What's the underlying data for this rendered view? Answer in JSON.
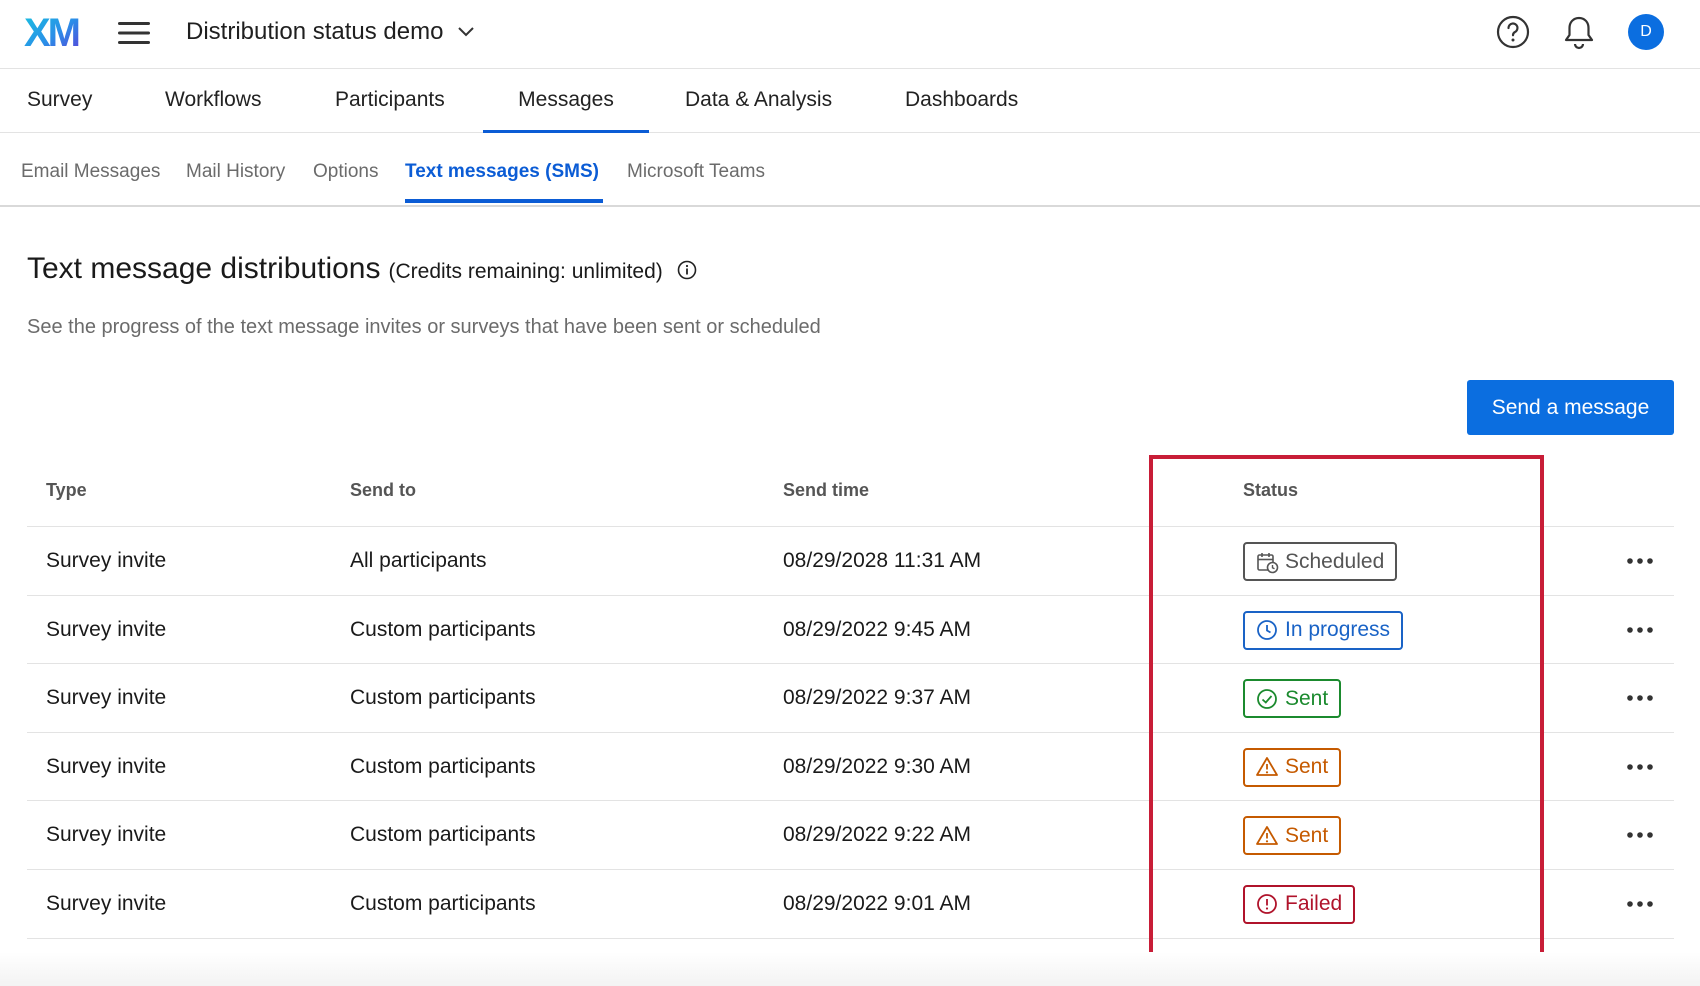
{
  "topbar": {
    "logo_text": "XM",
    "project_title": "Distribution status demo",
    "avatar_initial": "D",
    "icons": [
      "hamburger-menu-icon",
      "chevron-down-icon",
      "help-icon",
      "bell-icon"
    ]
  },
  "main_nav": {
    "tabs": [
      {
        "label": "Survey",
        "active": false
      },
      {
        "label": "Workflows",
        "active": false
      },
      {
        "label": "Participants",
        "active": false
      },
      {
        "label": "Messages",
        "active": true
      },
      {
        "label": "Data & Analysis",
        "active": false
      },
      {
        "label": "Dashboards",
        "active": false
      }
    ]
  },
  "sub_nav": {
    "tabs": [
      {
        "label": "Email Messages",
        "active": false
      },
      {
        "label": "Mail History",
        "active": false
      },
      {
        "label": "Options",
        "active": false
      },
      {
        "label": "Text messages (SMS)",
        "active": true
      },
      {
        "label": "Microsoft Teams",
        "active": false
      }
    ]
  },
  "page": {
    "title": "Text message distributions",
    "credits": "(Credits remaining: unlimited)",
    "description": "See the progress of the text message invites or surveys that have been sent or scheduled",
    "send_button": "Send a message"
  },
  "table": {
    "headers": {
      "type": "Type",
      "send_to": "Send to",
      "send_time": "Send time",
      "status": "Status"
    },
    "rows": [
      {
        "type": "Survey invite",
        "send_to": "All participants",
        "send_time": "08/29/2028 11:31 AM",
        "status": "Scheduled",
        "status_kind": "scheduled",
        "status_icon": "calendar-clock-icon"
      },
      {
        "type": "Survey invite",
        "send_to": "Custom participants",
        "send_time": "08/29/2022 9:45 AM",
        "status": "In progress",
        "status_kind": "progress",
        "status_icon": "clock-icon"
      },
      {
        "type": "Survey invite",
        "send_to": "Custom participants",
        "send_time": "08/29/2022 9:37 AM",
        "status": "Sent",
        "status_kind": "sent",
        "status_icon": "check-circle-icon"
      },
      {
        "type": "Survey invite",
        "send_to": "Custom participants",
        "send_time": "08/29/2022 9:30 AM",
        "status": "Sent",
        "status_kind": "warning",
        "status_icon": "warning-triangle-icon"
      },
      {
        "type": "Survey invite",
        "send_to": "Custom participants",
        "send_time": "08/29/2022 9:22 AM",
        "status": "Sent",
        "status_kind": "warning",
        "status_icon": "warning-triangle-icon"
      },
      {
        "type": "Survey invite",
        "send_to": "Custom participants",
        "send_time": "08/29/2022 9:01 AM",
        "status": "Failed",
        "status_kind": "failed",
        "status_icon": "error-circle-icon"
      }
    ]
  },
  "colors": {
    "primary": "#0b6ee0",
    "active_tab": "#0b5cd5",
    "highlight_border": "#c81d37",
    "scheduled": "#555555",
    "progress": "#1a63c6",
    "sent": "#1b8a2e",
    "warning": "#c55a00",
    "failed": "#b0132b"
  }
}
